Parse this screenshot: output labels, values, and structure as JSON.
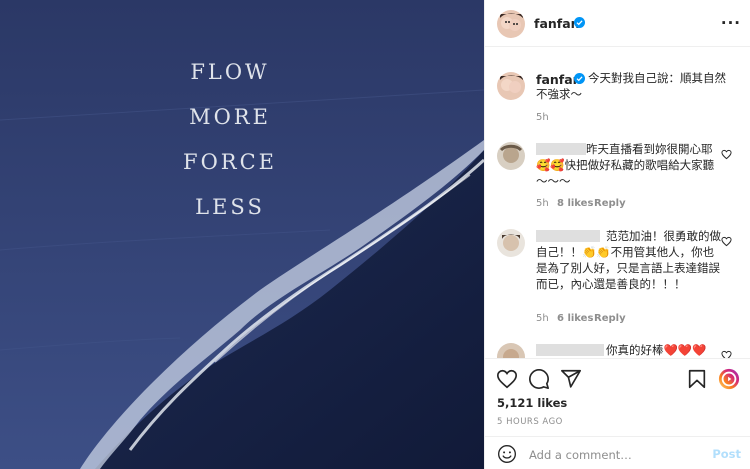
{
  "photo": {
    "quote_lines": [
      "FLOW",
      "MORE",
      "FORCE",
      "LESS"
    ]
  },
  "header": {
    "username": "fanfan",
    "more_icon": "more-horizontal-icon",
    "verified_icon": "verified-badge-icon"
  },
  "caption": {
    "username": "fanfan",
    "text": "今天對我自己說：順其自然不強求～",
    "time": "5h"
  },
  "comments": [
    {
      "text": "昨天直播看到妳很開心耶 🥰🥰快把做好私藏的歌唱給大家聽～～～",
      "time": "5h",
      "likes": "8 likes",
      "reply": "Reply"
    },
    {
      "text": "范范加油！很勇敢的做自己！！👏👏不用管其他人，你也是為了別人好，只是言語上表達錯誤而已，內心還是善良的！！！",
      "time": "5h",
      "likes": "6 likes",
      "reply": "Reply"
    },
    {
      "text": "你真的好棒❤️❤️❤️"
    }
  ],
  "actions": {
    "likes": "5,121 likes",
    "time_ago": "5 HOURS AGO",
    "icons": [
      "heart-icon",
      "comment-icon",
      "share-icon",
      "bookmark-icon"
    ]
  },
  "add_comment": {
    "placeholder": "Add a comment…",
    "post_label": "Post",
    "emoji_icon": "emoji-icon"
  },
  "colors": {
    "accent_blue": "#0095f6",
    "post_disabled": "#b2dffc",
    "heart_red": "#ed4956"
  }
}
